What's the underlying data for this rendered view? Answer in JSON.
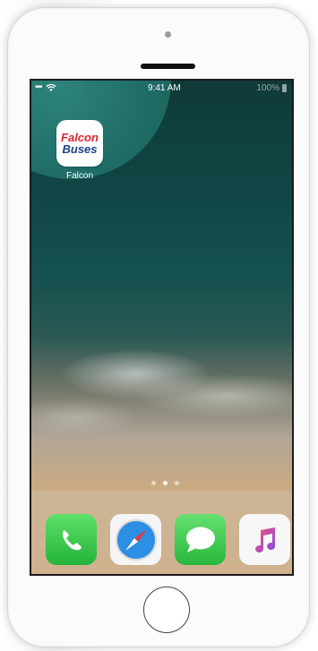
{
  "status_bar": {
    "signal": "•••",
    "time": "9:41 AM",
    "battery_pct": "100%"
  },
  "home_screen": {
    "apps": [
      {
        "label": "Falcon",
        "logo_top": "Falcon",
        "logo_bottom": "Buses",
        "logo_colors": [
          "#e0232a",
          "#1f3f88"
        ]
      }
    ],
    "page_indicator": {
      "pages": 3,
      "current": 2
    }
  },
  "dock": {
    "apps": [
      {
        "icon": "phone-icon"
      },
      {
        "icon": "safari-compass-icon"
      },
      {
        "icon": "messages-icon"
      },
      {
        "icon": "music-note-icon"
      }
    ]
  }
}
